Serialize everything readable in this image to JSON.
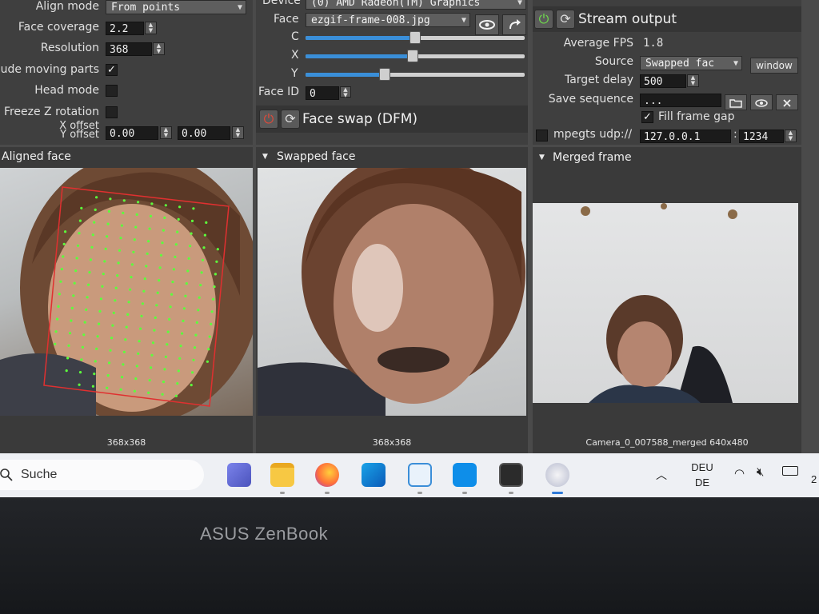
{
  "left_panel": {
    "align_mode": {
      "label": "Align mode",
      "value": "From points"
    },
    "face_coverage": {
      "label": "Face coverage",
      "value": "2.2"
    },
    "resolution": {
      "label": "Resolution",
      "value": "368"
    },
    "exclude_moving_parts": {
      "label": "lude moving parts",
      "checked": true
    },
    "head_mode": {
      "label": "Head mode",
      "checked": false
    },
    "freeze_z_rotation": {
      "label": "Freeze Z rotation",
      "checked": false
    },
    "xy_offset": {
      "label_x": "X offset",
      "label_y": "Y offset",
      "x_value": "0.00",
      "y_value": "0.00"
    }
  },
  "middle_panel": {
    "device": {
      "label": "Device",
      "value": "(0) AMD Radeon(TM) Graphics"
    },
    "face": {
      "label": "Face",
      "value": "ezgif-frame-008.jpg"
    },
    "sliders": [
      {
        "label": "C",
        "level": 0.5
      },
      {
        "label": "X",
        "level": 0.49
      },
      {
        "label": "Y",
        "level": 0.36
      }
    ],
    "face_id": {
      "label": "Face ID",
      "value": "0"
    },
    "face_swap_title": "Face swap (DFM)"
  },
  "right_panel": {
    "stream_title": "Stream output",
    "avg_fps": {
      "label": "Average FPS",
      "value": "1.8"
    },
    "source": {
      "label": "Source",
      "value": "Swapped fac",
      "window_button": "window"
    },
    "target_delay": {
      "label": "Target delay",
      "value": "500"
    },
    "save_sequence": {
      "label": "Save sequence",
      "value": "..."
    },
    "fill_frame_gap": {
      "label": "Fill frame gap",
      "checked": true
    },
    "mpegts": {
      "label": "mpegts udp://",
      "host": "127.0.0.1",
      "port": "1234"
    }
  },
  "views": {
    "aligned": {
      "title": "Aligned face",
      "caption": "368x368"
    },
    "swapped": {
      "title": "Swapped face",
      "caption": "368x368"
    },
    "merged": {
      "title": "Merged frame",
      "caption": "Camera_0_007588_merged 640x480"
    }
  },
  "taskbar": {
    "search_placeholder": "Suche",
    "language_top": "DEU",
    "language_bottom": "DE",
    "clock_partial": "2"
  },
  "laptop": {
    "brand": "ASUS ZenBook"
  },
  "colors": {
    "accent_blue": "#3a8fd9",
    "landmark_green": "#5cff3c",
    "face_box_red": "#e03030",
    "power_green": "#6fdc4c",
    "power_red": "#e04a3a"
  }
}
